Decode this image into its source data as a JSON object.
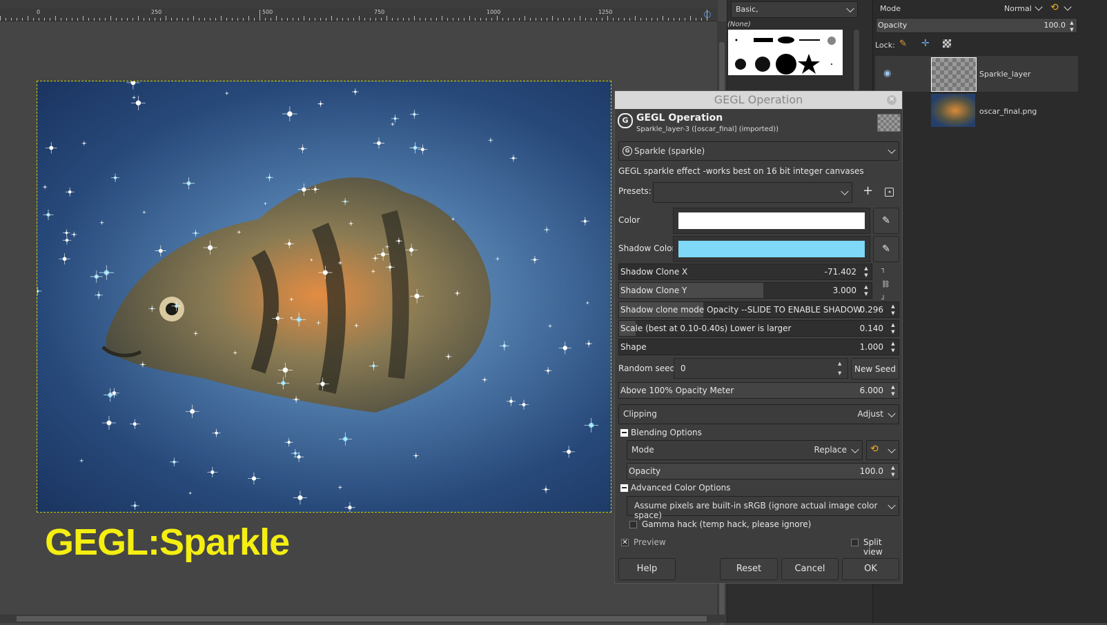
{
  "ruler": {
    "labels": [
      "0",
      "250",
      "500",
      "750",
      "1000",
      "1250"
    ]
  },
  "canvas": {
    "overlay_text": "GEGL:Sparkle"
  },
  "brushes": {
    "preset_select": "Basic,",
    "none_label": "(None)"
  },
  "layers": {
    "mode_label": "Mode",
    "mode_value": "Normal",
    "opacity_label": "Opacity",
    "opacity_value": "100.0",
    "lock_label": "Lock:",
    "items": [
      {
        "name": "Sparkle_layer"
      },
      {
        "name": "oscar_final.png"
      }
    ]
  },
  "dialog": {
    "window_title": "GEGL Operation",
    "header_title": "GEGL Operation",
    "header_subtitle": "Sparkle_layer-3 ([oscar_final] (imported))",
    "operation_select": "Sparkle (sparkle)",
    "description": "GEGL sparkle effect -works best on 16 bit integer canvases",
    "presets_label": "Presets:",
    "color_label": "Color",
    "color_value": "#ffffff",
    "shadow_color_label": "Shadow Color",
    "shadow_color_value": "#7fd8f7",
    "sliders": [
      {
        "label": "Shadow Clone X",
        "value": "-71.402",
        "fraction": 0.0
      },
      {
        "label": "Shadow Clone  Y",
        "value": "3.000",
        "fraction": 0.57
      },
      {
        "label": "Shadow clone mode Opacity --SLIDE TO ENABLE SHADOW",
        "value": "0.296",
        "fraction": 0.3
      },
      {
        "label": "Scale (best at 0.10-0.40s) Lower is larger",
        "value": "0.140",
        "fraction": 0.06
      },
      {
        "label": "Shape",
        "value": "1.000",
        "fraction": 0.0
      }
    ],
    "random_seed_label": "Random seed",
    "random_seed_value": "0",
    "new_seed_button": "New Seed",
    "opacity_meter_label": "Above 100% Opacity Meter",
    "opacity_meter_value": "6.000",
    "clipping_label": "Clipping",
    "clipping_value": "Adjust",
    "blending_label": "Blending Options",
    "blend_mode_label": "Mode",
    "blend_mode_value": "Replace",
    "blend_opacity_label": "Opacity",
    "blend_opacity_value": "100.0",
    "advanced_label": "Advanced Color Options",
    "color_space_select": "Assume pixels are built-in sRGB (ignore actual image color space)",
    "gamma_label": "Gamma hack (temp hack, please ignore)",
    "preview_label": "Preview",
    "split_view_label": "Split view",
    "buttons": {
      "help": "Help",
      "reset": "Reset",
      "cancel": "Cancel",
      "ok": "OK"
    }
  },
  "colors": {
    "accent": "#f4ee11",
    "sky": "#7fd8f7"
  }
}
